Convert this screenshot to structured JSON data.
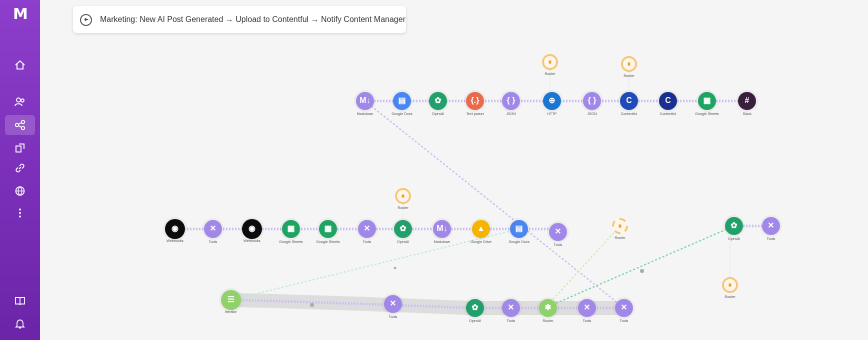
{
  "app": {
    "logo": "M",
    "scenario_title": "Marketing: New AI Post Generated → Upload to Contentful → Notify Content Manager"
  },
  "sidebar": {
    "items": [
      {
        "name": "home-icon",
        "active": false
      },
      {
        "name": "team-icon",
        "active": false
      },
      {
        "name": "scenarios-icon",
        "active": true
      },
      {
        "name": "templates-icon",
        "active": false
      },
      {
        "name": "connections-icon",
        "active": false
      },
      {
        "name": "webhooks-icon",
        "active": false
      },
      {
        "name": "more-icon",
        "active": false
      },
      {
        "name": "docs-icon",
        "active": false
      },
      {
        "name": "notifications-icon",
        "active": false
      }
    ]
  },
  "colors": {
    "flow_purple": "#a188e8",
    "flow_green": "#4ec98c",
    "openai_green": "#22a06b",
    "sheets_green": "#1fa463",
    "orange": "#f29b24",
    "http_blue": "#1976d2",
    "slack_dark": "#3a1f3d"
  },
  "modules": {
    "row1": [
      "Markdown",
      "Google Docs",
      "OpenAI",
      "Text parser",
      "JSON",
      "HTTP",
      "JSON",
      "Contentful",
      "Contentful",
      "Google Sheets",
      "Slack"
    ],
    "row2": [
      "Webhooks",
      "Tools",
      "Webhooks",
      "Google Sheets",
      "Google Sheets",
      "Tools",
      "OpenAI",
      "Markdown",
      "Google Drive",
      "Google Docs",
      "Tools"
    ],
    "row3": [
      "Iterator",
      "Tools",
      "OpenAI",
      "Tools",
      "Router",
      "Tools",
      "Tools"
    ],
    "right": [
      "OpenAI",
      "Tools"
    ]
  }
}
